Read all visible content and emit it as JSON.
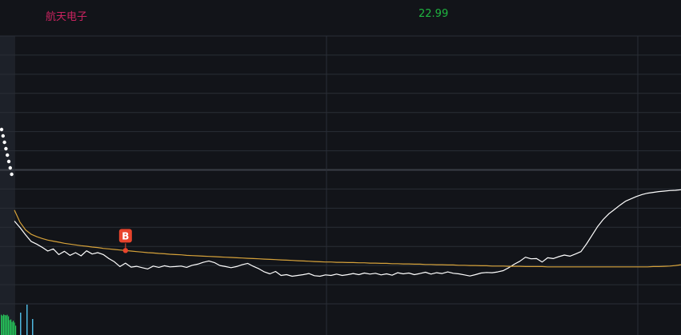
{
  "header": {
    "stock_name": "航天电子",
    "price": "22.99",
    "name_color": "#c8235f",
    "price_color": "#1fb640"
  },
  "colors": {
    "background": "#121419",
    "grid": "#2a2e36",
    "price_line": "#ffffff",
    "avg_line": "#d6a23a",
    "buy_marker": "#e8442c",
    "volume_up": "#26c45a",
    "volume_down": "#4fb8e0"
  },
  "chart_data": {
    "type": "line",
    "title": "",
    "x": [
      0,
      2,
      4,
      6,
      8,
      10,
      12,
      14,
      16,
      18,
      20,
      22,
      24,
      26,
      28,
      30,
      32,
      34,
      36,
      38,
      40,
      42,
      44,
      46,
      48,
      50,
      52,
      54,
      56,
      58,
      60,
      62,
      64,
      66,
      68,
      70,
      72,
      74,
      76,
      78,
      80,
      82,
      84,
      86,
      88,
      90,
      92,
      94,
      96,
      98,
      100,
      102,
      104,
      106,
      108,
      110,
      112,
      114,
      116,
      118,
      120,
      122,
      124,
      126,
      128,
      130,
      132,
      134,
      136,
      138,
      140,
      142,
      144,
      146,
      148,
      150,
      152,
      154,
      156,
      158,
      160,
      162,
      164,
      166,
      168,
      170,
      172,
      174,
      176,
      178,
      180,
      182,
      184,
      186,
      188,
      190,
      192,
      194,
      196,
      198,
      200,
      202,
      204,
      206,
      208,
      210,
      212,
      214,
      216,
      218,
      220,
      222,
      224,
      226,
      228,
      230,
      232,
      234,
      236,
      238,
      240
    ],
    "ylim": [
      0,
      100
    ],
    "grid": true,
    "series": [
      {
        "values": [
          30.9,
          28.5,
          25.8,
          23.3,
          22.3,
          21.1,
          19.7,
          20.5,
          18.4,
          19.6,
          18.1,
          19.1,
          17.9,
          19.8,
          18.6,
          19.1,
          18.4,
          16.9,
          15.7,
          13.9,
          15.2,
          13.7,
          14.0,
          13.5,
          13.0,
          14.1,
          13.6,
          14.2,
          13.8,
          13.9,
          14.1,
          13.6,
          14.4,
          14.8,
          15.5,
          16.0,
          15.4,
          14.3,
          13.9,
          13.5,
          13.9,
          14.6,
          15.1,
          14.0,
          13.1,
          11.9,
          11.2,
          12.1,
          10.6,
          10.9,
          10.3,
          10.6,
          10.9,
          11.3,
          10.5,
          10.3,
          10.8,
          10.6,
          11.1,
          10.6,
          10.9,
          11.3,
          10.9,
          11.5,
          11.1,
          11.4,
          10.8,
          11.2,
          10.7,
          11.6,
          11.2,
          11.5,
          10.9,
          11.3,
          11.8,
          11.1,
          11.6,
          11.3,
          11.9,
          11.4,
          11.2,
          10.8,
          10.4,
          10.9,
          11.5,
          11.7,
          11.6,
          11.9,
          12.4,
          13.5,
          14.8,
          15.9,
          17.4,
          16.8,
          16.9,
          15.6,
          17.2,
          16.9,
          17.6,
          18.2,
          17.8,
          18.6,
          19.5,
          22.4,
          25.6,
          28.9,
          31.5,
          33.6,
          35.2,
          36.8,
          38.3,
          39.2,
          40.1,
          40.8,
          41.3,
          41.6,
          41.9,
          42.1,
          42.3,
          42.4,
          42.6
        ],
        "color": "#ffffff"
      },
      {
        "values": [
          35.0,
          30.5,
          27.6,
          26.0,
          25.1,
          24.4,
          23.8,
          23.4,
          23.0,
          22.6,
          22.3,
          22.0,
          21.7,
          21.5,
          21.2,
          21.0,
          20.7,
          20.5,
          20.3,
          20.1,
          19.9,
          19.7,
          19.5,
          19.3,
          19.1,
          19.0,
          18.8,
          18.7,
          18.5,
          18.4,
          18.3,
          18.1,
          18.0,
          17.9,
          17.8,
          17.7,
          17.6,
          17.5,
          17.4,
          17.3,
          17.2,
          17.1,
          17.0,
          16.9,
          16.8,
          16.7,
          16.6,
          16.5,
          16.4,
          16.3,
          16.2,
          16.1,
          16.0,
          15.9,
          15.8,
          15.7,
          15.6,
          15.6,
          15.5,
          15.5,
          15.4,
          15.4,
          15.3,
          15.3,
          15.2,
          15.2,
          15.1,
          15.1,
          15.0,
          15.0,
          14.9,
          14.9,
          14.8,
          14.8,
          14.7,
          14.7,
          14.6,
          14.6,
          14.5,
          14.5,
          14.4,
          14.4,
          14.3,
          14.3,
          14.2,
          14.2,
          14.1,
          14.1,
          14.1,
          14.0,
          14.0,
          14.0,
          13.9,
          13.9,
          13.9,
          13.9,
          13.8,
          13.8,
          13.8,
          13.8,
          13.8,
          13.8,
          13.8,
          13.8,
          13.8,
          13.8,
          13.8,
          13.8,
          13.8,
          13.8,
          13.8,
          13.8,
          13.8,
          13.8,
          13.8,
          13.9,
          13.9,
          14.0,
          14.1,
          14.3,
          14.6
        ],
        "color": "#d6a23a"
      }
    ],
    "markers": [
      {
        "label": "B",
        "x": 40,
        "y": 19.9
      }
    ],
    "volume": {
      "x": [
        0,
        1,
        2,
        3,
        4,
        5,
        6,
        7,
        8,
        9,
        10,
        11,
        12
      ],
      "values": [
        65,
        62,
        66,
        64,
        63,
        65,
        60,
        48,
        50,
        42,
        46,
        40,
        30
      ],
      "ylim": [
        0,
        100
      ]
    }
  }
}
